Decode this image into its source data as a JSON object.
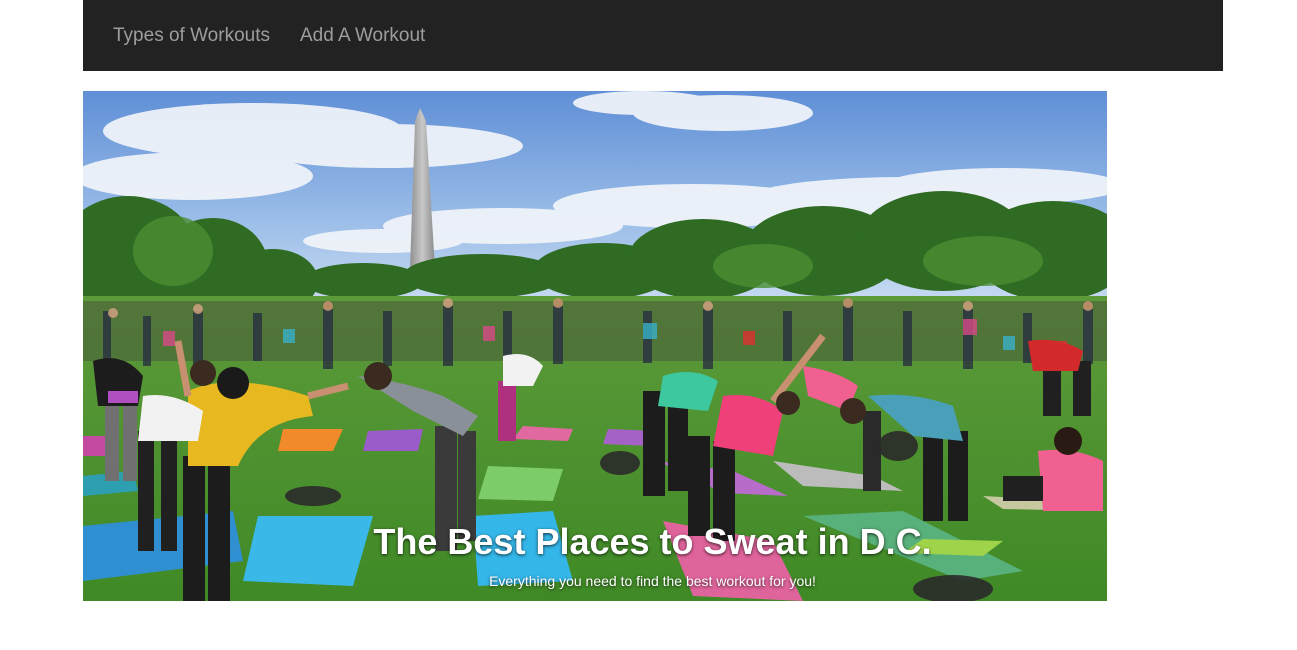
{
  "nav": {
    "items": [
      {
        "label": "Types of Workouts"
      },
      {
        "label": "Add A Workout"
      }
    ],
    "background": "#222222",
    "link_color": "#9d9d9d"
  },
  "hero": {
    "title": "The Best Places to Sweat in D.C.",
    "subtitle": "Everything you need to find the best workout for you!"
  }
}
